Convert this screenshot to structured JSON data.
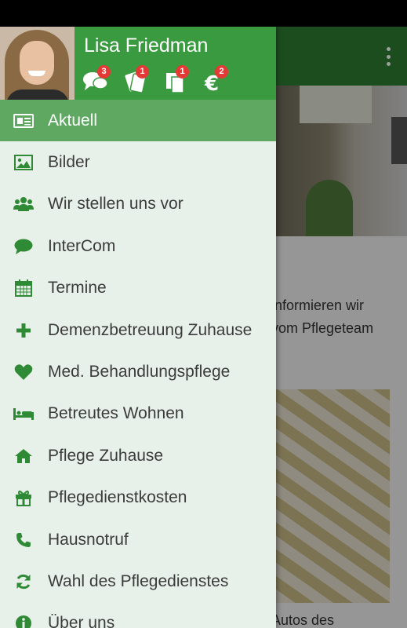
{
  "colors": {
    "accent": "#3a9a40",
    "toolbar": "#2e7d32",
    "active_item": "#5fa862",
    "drawer_bg": "#e8f1e9",
    "badge": "#e53935",
    "icon": "#2f8a35"
  },
  "user": {
    "name": "Lisa Friedman"
  },
  "header_icons": [
    {
      "icon": "chat-bubbles-icon",
      "badge": "3"
    },
    {
      "icon": "notes-icon",
      "badge": "1"
    },
    {
      "icon": "documents-icon",
      "badge": "1"
    },
    {
      "icon": "euro-icon",
      "badge": "2"
    }
  ],
  "menu": {
    "items": [
      {
        "label": "Aktuell",
        "icon": "newspaper-icon",
        "active": true
      },
      {
        "label": "Bilder",
        "icon": "image-icon"
      },
      {
        "label": "Wir stellen uns vor",
        "icon": "users-icon"
      },
      {
        "label": "InterCom",
        "icon": "comment-icon"
      },
      {
        "label": "Termine",
        "icon": "calendar-icon"
      },
      {
        "label": "Demenzbetreuung Zuhause",
        "icon": "plus-icon"
      },
      {
        "label": "Med. Behandlungspflege",
        "icon": "heart-icon"
      },
      {
        "label": "Betreutes Wohnen",
        "icon": "bed-icon"
      },
      {
        "label": "Pflege Zuhause",
        "icon": "home-icon"
      },
      {
        "label": "Pflegedienstkosten",
        "icon": "gift-icon"
      },
      {
        "label": "Hausnotruf",
        "icon": "phone-icon"
      },
      {
        "label": "Wahl des Pflegedienstes",
        "icon": "refresh-icon"
      },
      {
        "label": "Über uns",
        "icon": "info-icon"
      }
    ]
  },
  "background": {
    "text_line1": "informieren wir",
    "text_line2": "vom Pflegeteam",
    "text_line3": "Autos des"
  }
}
